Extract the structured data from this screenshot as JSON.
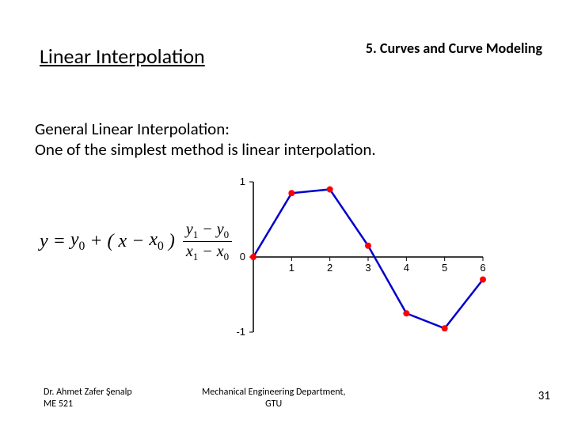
{
  "header": {
    "title": "Linear Interpolation",
    "chapter": "5. Curves and Curve Modeling"
  },
  "body": {
    "line1": "General Linear Interpolation:",
    "line2": "One of the simplest method is linear interpolation."
  },
  "formula": {
    "y": "y",
    "eq": "=",
    "y0": "y",
    "y0s": "0",
    "plus": "+",
    "lp": "(",
    "x": "x",
    "minus": "−",
    "x0": "x",
    "x0s": "0",
    "rp": ")",
    "num_y1": "y",
    "num_y1s": "1",
    "num_minus": "−",
    "num_y0": "y",
    "num_y0s": "0",
    "den_x1": "x",
    "den_x1s": "1",
    "den_minus": "−",
    "den_x0": "x",
    "den_x0s": "0"
  },
  "chart_data": {
    "type": "line",
    "x": [
      0,
      1,
      2,
      3,
      4,
      5,
      6
    ],
    "y": [
      0,
      0.85,
      0.9,
      0.15,
      -0.75,
      -0.95,
      -0.3
    ],
    "xlabel": "",
    "ylabel": "",
    "xlim": [
      0,
      6
    ],
    "ylim": [
      -1,
      1
    ],
    "xticks": [
      0,
      1,
      2,
      3,
      4,
      5,
      6
    ],
    "yticks": [
      -1,
      0,
      1
    ],
    "line_color": "#0000cc",
    "point_color": "#ff0000"
  },
  "footer": {
    "author1": "Dr. Ahmet Zafer Şenalp",
    "author2": "ME 521",
    "dept1": "Mechanical Engineering Department,",
    "dept2": "GTU",
    "page": "31"
  }
}
